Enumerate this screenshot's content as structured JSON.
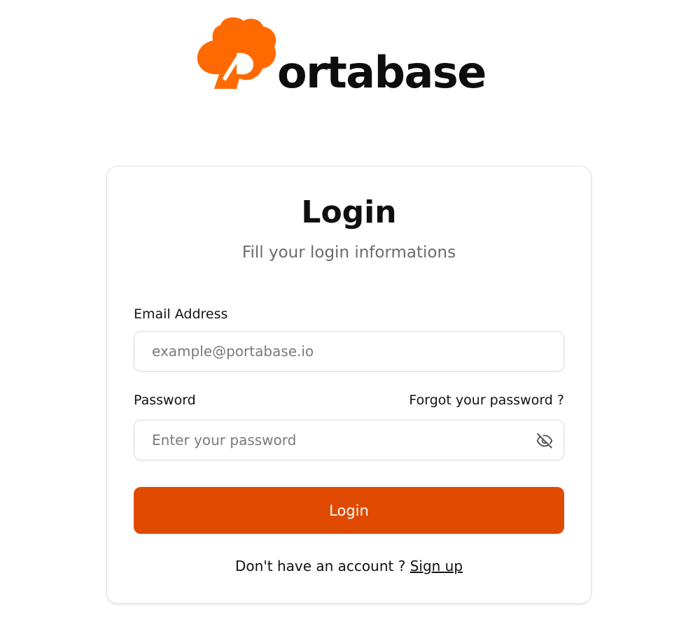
{
  "brand": {
    "name": "Portabase",
    "wordmark_rest": "ortabase",
    "accent_color": "#ff6a00"
  },
  "login_card": {
    "title": "Login",
    "subtitle": "Fill your login informations",
    "email": {
      "label": "Email Address",
      "placeholder": "example@portabase.io",
      "value": ""
    },
    "password": {
      "label": "Password",
      "placeholder": "Enter your password",
      "value": "",
      "forgot_label": "Forgot your password ?",
      "toggle_icon": "eye-off-icon"
    },
    "submit_label": "Login",
    "submit_color": "#e04a00",
    "signup_prompt": "Don't have an account ?",
    "signup_label": "Sign up"
  }
}
